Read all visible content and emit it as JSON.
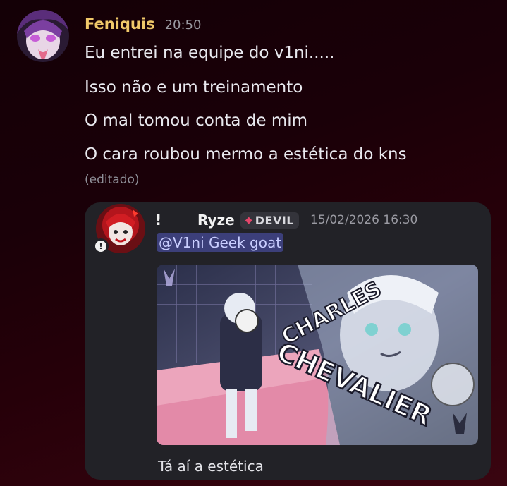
{
  "message": {
    "author": "Feniquis",
    "time": "20:50",
    "lines": [
      "Eu entrei na equipe do v1ni.....",
      "Isso não e um treinamento",
      "O mal tomou conta de mim",
      "O cara roubou mermo a estética do kns"
    ],
    "edited": "(editado)",
    "author_color": "#f0c96a"
  },
  "forwarded": {
    "prefix": "!",
    "author": "Ryze",
    "tag": "DEVIL",
    "tag_icon": "gem-icon",
    "timestamp": "15/02/2026 16:30",
    "mention": "@V1ni Geek goat",
    "image_text": [
      "CHARLES",
      "CHEVALIER"
    ],
    "text": "Tá aí a estética",
    "status_icon": "exclamation-icon"
  }
}
